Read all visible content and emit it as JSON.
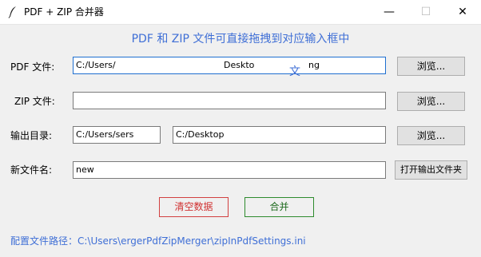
{
  "window": {
    "title": "PDF + ZIP 合并器",
    "minimize_glyph": "—",
    "maximize_glyph": "☐",
    "close_glyph": "✕"
  },
  "banner": "PDF 和 ZIP 文件可直接拖拽到对应输入框中",
  "rows": {
    "pdf": {
      "label": "PDF 文件:",
      "value_left": "C:/Users/",
      "value_right": "Deskto",
      "value_tail": "ng",
      "overlay": "文",
      "browse": "浏览..."
    },
    "zip": {
      "label": "ZIP 文件:",
      "value": "",
      "browse": "浏览..."
    },
    "output": {
      "label": "输出目录:",
      "value_left": "C:/Users/sers",
      "value_right": "C:/Desktop",
      "browse": "浏览..."
    },
    "filename": {
      "label": "新文件名:",
      "value": "new",
      "open_folder": "打开输出文件夹"
    }
  },
  "actions": {
    "clear": "清空数据",
    "merge": "合并"
  },
  "footer": {
    "label": "配置文件路径：",
    "path": "C:\\Users\\ergerPdfZipMerger\\zipInPdfSettings.ini"
  },
  "colors": {
    "accent_blue": "#3f6fd6",
    "clear_red": "#d03030",
    "merge_green": "#1f6b1f"
  }
}
